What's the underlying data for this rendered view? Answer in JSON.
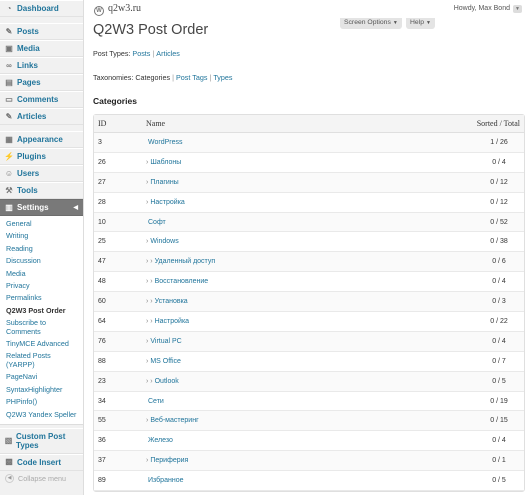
{
  "header": {
    "site_name": "q2w3.ru",
    "howdy": "Howdy, Max Bond",
    "screen_options": "Screen Options",
    "help": "Help"
  },
  "sidebar": {
    "dashboard": "Dashboard",
    "posts": "Posts",
    "media": "Media",
    "links": "Links",
    "pages": "Pages",
    "comments": "Comments",
    "articles": "Articles",
    "appearance": "Appearance",
    "plugins": "Plugins",
    "users": "Users",
    "tools": "Tools",
    "settings": "Settings",
    "settings_sub": [
      "General",
      "Writing",
      "Reading",
      "Discussion",
      "Media",
      "Privacy",
      "Permalinks",
      "Q2W3 Post Order",
      "Subscribe to Comments",
      "TinyMCE Advanced",
      "Related Posts (YARPP)",
      "PageNavi",
      "SyntaxHighlighter",
      "PHPinfo()",
      "Q2W3 Yandex Speller"
    ],
    "custom_post_types": "Custom Post Types",
    "code_insert": "Code Insert",
    "collapse": "Collapse menu"
  },
  "main": {
    "title": "Q2W3 Post Order",
    "post_types_label": "Post Types:",
    "post_types": [
      "Posts",
      "Articles"
    ],
    "taxonomies_label": "Taxonomies:",
    "taxonomies_current": "Categories",
    "taxonomies": [
      "Post Tags",
      "Types"
    ],
    "section": "Categories",
    "columns": {
      "id": "ID",
      "name": "Name",
      "sorted": "Sorted / Total"
    },
    "rows": [
      {
        "id": "3",
        "indent": "",
        "name": "WordPress",
        "sorted": "1 / 26"
      },
      {
        "id": "26",
        "indent": "›",
        "name": "Шаблоны",
        "sorted": "0 / 4"
      },
      {
        "id": "27",
        "indent": "›",
        "name": "Плагины",
        "sorted": "0 / 12"
      },
      {
        "id": "28",
        "indent": "›",
        "name": "Настройка",
        "sorted": "0 / 12"
      },
      {
        "id": "10",
        "indent": "",
        "name": "Софт",
        "sorted": "0 / 52"
      },
      {
        "id": "25",
        "indent": "›",
        "name": "Windows",
        "sorted": "0 / 38"
      },
      {
        "id": "47",
        "indent": "› ›",
        "name": "Удаленный доступ",
        "sorted": "0 / 6"
      },
      {
        "id": "48",
        "indent": "› ›",
        "name": "Восстановление",
        "sorted": "0 / 4"
      },
      {
        "id": "60",
        "indent": "› ›",
        "name": "Установка",
        "sorted": "0 / 3"
      },
      {
        "id": "64",
        "indent": "› ›",
        "name": "Настройка",
        "sorted": "0 / 22"
      },
      {
        "id": "76",
        "indent": "›",
        "name": "Virtual PC",
        "sorted": "0 / 4"
      },
      {
        "id": "88",
        "indent": "›",
        "name": "MS Office",
        "sorted": "0 / 7"
      },
      {
        "id": "23",
        "indent": "› ›",
        "name": "Outlook",
        "sorted": "0 / 5"
      },
      {
        "id": "34",
        "indent": "",
        "name": "Сети",
        "sorted": "0 / 19"
      },
      {
        "id": "55",
        "indent": "›",
        "name": "Веб-мастеринг",
        "sorted": "0 / 15"
      },
      {
        "id": "36",
        "indent": "",
        "name": "Железо",
        "sorted": "0 / 4"
      },
      {
        "id": "37",
        "indent": "›",
        "name": "Периферия",
        "sorted": "0 / 1"
      },
      {
        "id": "89",
        "indent": "",
        "name": "Избранное",
        "sorted": "0 / 5"
      }
    ]
  },
  "colors": {
    "link": "#21759b",
    "menu_current": "#797979",
    "sidebar_bg": "#f1f1f1"
  }
}
